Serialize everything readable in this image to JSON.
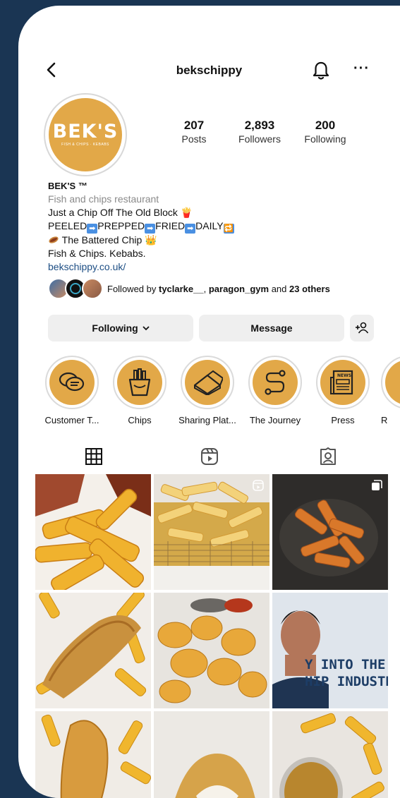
{
  "header": {
    "username": "bekschippy"
  },
  "avatar": {
    "logo_text": "BEK'S",
    "logo_subtext": "FISH & CHIPS · KEBABS"
  },
  "stats": [
    {
      "value": "207",
      "label": "Posts"
    },
    {
      "value": "2,893",
      "label": "Followers"
    },
    {
      "value": "200",
      "label": "Following"
    }
  ],
  "bio": {
    "name": "BEK'S ™",
    "category": "Fish and chips restaurant",
    "line1": "Just a Chip Off The Old Block 🍟",
    "line2_parts": [
      "PEELED",
      "PREPPED",
      "FRIED",
      "DAILY"
    ],
    "line3": "The Battered Chip 👑",
    "line4": "Fish & Chips. Kebabs.",
    "link": "bekschippy.co.uk/"
  },
  "followed_by": {
    "prefix": "Followed by ",
    "user1": "tyclarke__",
    "sep": ", ",
    "user2": "paragon_gym",
    "mid": " and ",
    "others": "23 others"
  },
  "actions": {
    "following": "Following",
    "message": "Message"
  },
  "highlights": [
    {
      "label": "Customer T...",
      "icon": "speech-bubbles-icon"
    },
    {
      "label": "Chips",
      "icon": "fries-icon"
    },
    {
      "label": "Sharing Plat...",
      "icon": "pizza-box-icon"
    },
    {
      "label": "The Journey",
      "icon": "route-icon"
    },
    {
      "label": "Press",
      "icon": "newspaper-icon"
    },
    {
      "label": "R",
      "icon": "partial-highlight"
    }
  ],
  "tabs": [
    "grid-icon",
    "reels-icon",
    "tagged-icon"
  ],
  "posts": [
    {
      "kind": "photo",
      "badge": "none"
    },
    {
      "kind": "reel",
      "badge": "reel-icon"
    },
    {
      "kind": "carousel",
      "badge": "carousel-icon"
    },
    {
      "kind": "photo",
      "badge": "none"
    },
    {
      "kind": "photo",
      "badge": "none"
    },
    {
      "kind": "photo",
      "badge": "none",
      "overlay_line1": "Y INTO THE",
      "overlay_line2": "HIP INDUSTR"
    },
    {
      "kind": "photo",
      "badge": "none"
    },
    {
      "kind": "photo",
      "badge": "none"
    },
    {
      "kind": "photo",
      "badge": "none"
    }
  ],
  "colors": {
    "brand": "#e2a848",
    "background": "#1a3553",
    "link": "#1d4e84"
  }
}
